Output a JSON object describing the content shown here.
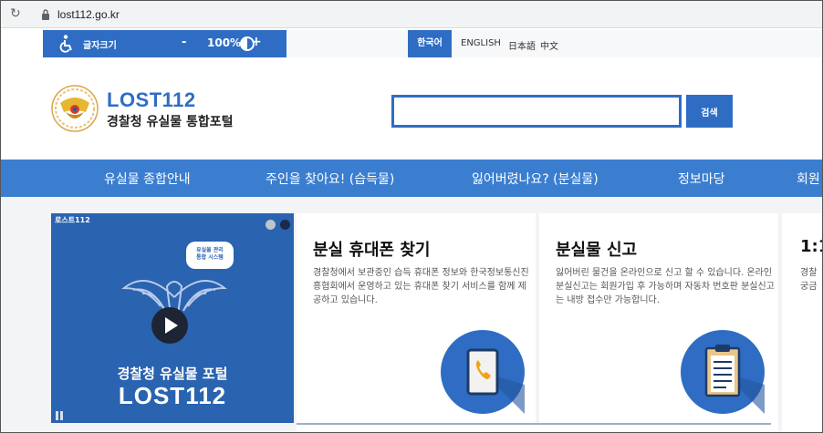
{
  "browser": {
    "url": "lost112.go.kr"
  },
  "utility": {
    "font_size_label": "글자크기",
    "minus": "-",
    "zoom": "100%",
    "plus": "+",
    "languages": [
      "한국어",
      "ENGLISH",
      "日本語",
      "中文"
    ]
  },
  "header": {
    "logo_title": "LOST112",
    "logo_subtitle": "경찰청 유실물 통합포털",
    "search_button": "검색",
    "search_value": ""
  },
  "nav": {
    "items": [
      "유실물 종합안내",
      "주인을 찾아요! (습득물)",
      "잃어버렸나요? (분실물)",
      "정보마당",
      "회원"
    ]
  },
  "video": {
    "label": "로스트112",
    "bubble_line1": "유실물 관리",
    "bubble_line2": "통합 시스템",
    "title_line1": "경찰청 유실물 포털",
    "title_line2": "LOST112"
  },
  "cards": [
    {
      "title": "분실 휴대폰 찾기",
      "desc": "경찰청에서 보관중인 습득 휴대폰 정보와 한국정보통신진흥협회에서 운영하고 있는 휴대폰 찾기 서비스를 함께 제공하고 있습니다."
    },
    {
      "title": "분실물 신고",
      "desc": "잃어버린 물건을 온라인으로 신고 할 수 있습니다. 온라인 분실신고는 회원가입 후 가능하며 자동차 번호판 분실신고는 내방 접수만 가능합니다."
    },
    {
      "title": "1:1",
      "desc": "경찰 궁금"
    }
  ],
  "colors": {
    "primary": "#2f6dc4",
    "nav": "#3b7ed0",
    "dark_circle": "#1d2433"
  }
}
